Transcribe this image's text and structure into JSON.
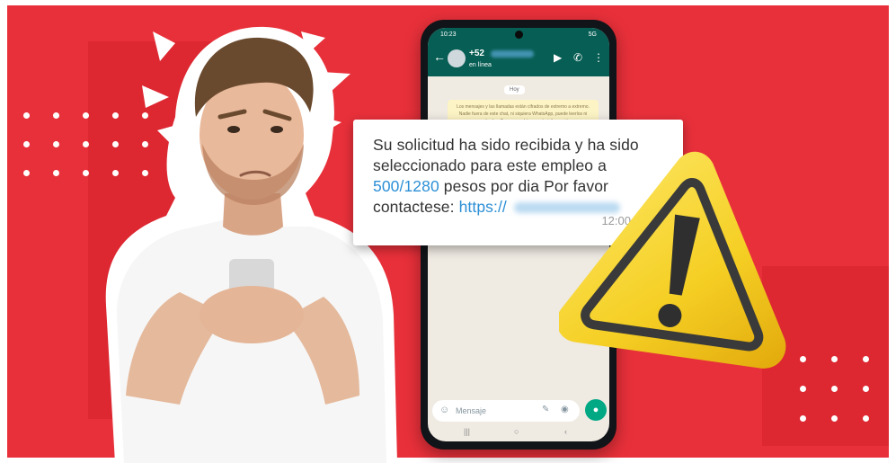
{
  "colors": {
    "background": "#e8303a",
    "whatsapp_header": "#075e54",
    "link_blue": "#2c8fd6",
    "warning_yellow": "#f9d92b"
  },
  "phone": {
    "status_time": "10:23",
    "status_right": "5G",
    "contact_name": "+52",
    "contact_status": "en línea",
    "date_label": "Hoy",
    "encryption_notice": "Los mensajes y las llamadas están cifrados de extremo a extremo. Nadie fuera de este chat, ni siquiera WhatsApp, puede leerlos ni escucharlos. Toca para obtener más información.",
    "compose_placeholder": "Mensaje"
  },
  "message": {
    "text_part1": "Su solicitud ha sido recibida y ha sido seleccionado para este empleo a ",
    "amount": "500/1280",
    "text_part2": " pesos por dia Por favor contactese: ",
    "link_prefix": "https://",
    "time": "12:00"
  },
  "icons": {
    "back": "arrow-left-icon",
    "video": "video-camera-icon",
    "call": "phone-icon",
    "menu": "more-vertical-icon",
    "emoji": "emoji-icon",
    "attach": "paperclip-icon",
    "camera": "camera-icon",
    "mic": "microphone-icon",
    "warning": "warning-triangle-icon"
  }
}
